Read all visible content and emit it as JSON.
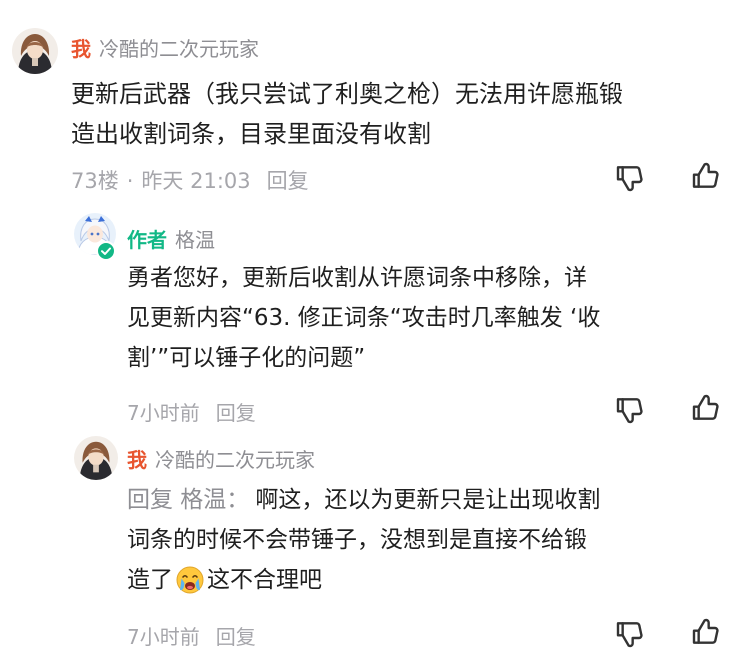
{
  "comment": {
    "badge": "我",
    "username": "冷酷的二次元玩家",
    "lines": [
      "更新后武器（我只尝试了利奥之枪）无法用许愿瓶锻",
      "造出收割词条，目录里面没有收割"
    ],
    "floor": "73楼",
    "separator": "·",
    "time": "昨天 21:03",
    "reply_label": "回复"
  },
  "reply1": {
    "badge": "作者",
    "username": "格温",
    "lines": [
      "勇者您好，更新后收割从许愿词条中移除，详",
      "见更新内容“63. 修正词条“攻击时几率触发 ‘收",
      "割’”可以锤子化的问题”"
    ],
    "time": "7小时前",
    "reply_label": "回复"
  },
  "reply2": {
    "badge": "我",
    "username": "冷酷的二次元玩家",
    "reply_prefix": "回复 格温：",
    "lines": [
      "啊这，还以为更新只是让出现收割",
      "词条的时候不会带锤子，没想到是直接不给锻",
      "造了"
    ],
    "line3_suffix": "这不合理吧",
    "time": "7小时前",
    "reply_label": "回复"
  },
  "colors": {
    "self_badge": "#e8552f",
    "author_badge": "#12b886",
    "verified": "#12b886",
    "meta": "#a6a6ab"
  },
  "icons": {
    "dislike": "thumbs-down-icon",
    "like": "thumbs-up-icon",
    "emoji": "crying-face-emoji-icon"
  }
}
